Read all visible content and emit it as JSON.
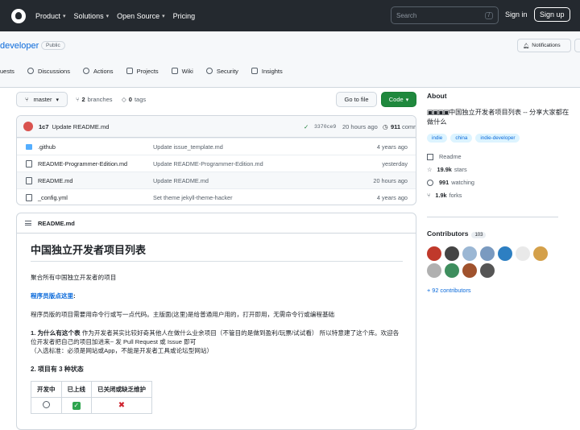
{
  "topnav": {
    "items": [
      "Product",
      "Solutions",
      "Open Source",
      "Pricing"
    ],
    "search_placeholder": "Search",
    "search_key": "/",
    "signin": "Sign in",
    "signup": "Sign up"
  },
  "repo": {
    "name": "developer",
    "visibility": "Public",
    "notifications": "Notifications"
  },
  "tabs": [
    "uests",
    "Discussions",
    "Actions",
    "Projects",
    "Wiki",
    "Security",
    "Insights"
  ],
  "toolbar": {
    "branch": "master",
    "branches_count": "2",
    "branches_label": "branches",
    "tags_count": "0",
    "tags_label": "tags",
    "goto_file": "Go to file",
    "code": "Code"
  },
  "latest_commit": {
    "author": "1c7",
    "message": "Update README.md",
    "hash": "3370ce9",
    "time": "20 hours ago",
    "commits_count": "911",
    "commits_label": "commits"
  },
  "files": [
    {
      "name": ".github",
      "type": "folder",
      "message": "Update issue_template.md",
      "age": "4 years ago"
    },
    {
      "name": "README-Programmer-Edition.md",
      "type": "file",
      "message": "Update README-Programmer-Edition.md",
      "age": "yesterday"
    },
    {
      "name": "README.md",
      "type": "file",
      "message": "Update README.md",
      "age": "20 hours ago"
    },
    {
      "name": "_config.yml",
      "type": "file",
      "message": "Set theme jekyll-theme-hacker",
      "age": "4 years ago"
    }
  ],
  "readme": {
    "header": "README.md",
    "title": "中国独立开发者项目列表",
    "intro": "聚合所有中国独立开发者的项目",
    "programmer_link": "程序员版点这里",
    "programmer_colon": ":",
    "programmer_desc": "程序员版的项目需要用命令行或写一点代码。主版面(这里)是给普通用户用的，打开即用，无需命令行或编程基础",
    "why_title": "1. 为什么有这个表",
    "why_body": "作为开发者其实比较好奇其他人在做什么业余项目（不管目的是做到盈利/玩票/试试看） 所以特意建了这个库。欢迎各位开发者把自己的项目加进来~ 发 Pull Request 或 Issue 即可",
    "why_note": "（入选标准：必须是网站或App，不能是开发者工具或论坛型网站）",
    "status_title": "2. 项目有 3 种状态",
    "status_headers": [
      "开发中",
      "已上线",
      "已关闭或缺乏维护"
    ]
  },
  "about": {
    "title": "About",
    "description": "中国独立开发者项目列表 -- 分享大家都在做什么",
    "topics": [
      "indie",
      "china",
      "indie-developer"
    ],
    "readme_label": "Readme",
    "stars": "19.9k",
    "stars_label": "stars",
    "watching": "991",
    "watching_label": "watching",
    "forks": "1.9k",
    "forks_label": "forks"
  },
  "contributors": {
    "title": "Contributors",
    "count": "103",
    "more": "+ 92 contributors",
    "avatar_colors": [
      "#c0392b",
      "#444444",
      "#9bb7d4",
      "#7a9ac0",
      "#2d7fc2",
      "#e9e9e9",
      "#d4a04a",
      "#b0b0b0",
      "#3e8e5e",
      "#a0522d",
      "#555555"
    ]
  },
  "colors": {
    "topbar": "#24292f",
    "link": "#0969da",
    "green_button": "#1f883d"
  }
}
